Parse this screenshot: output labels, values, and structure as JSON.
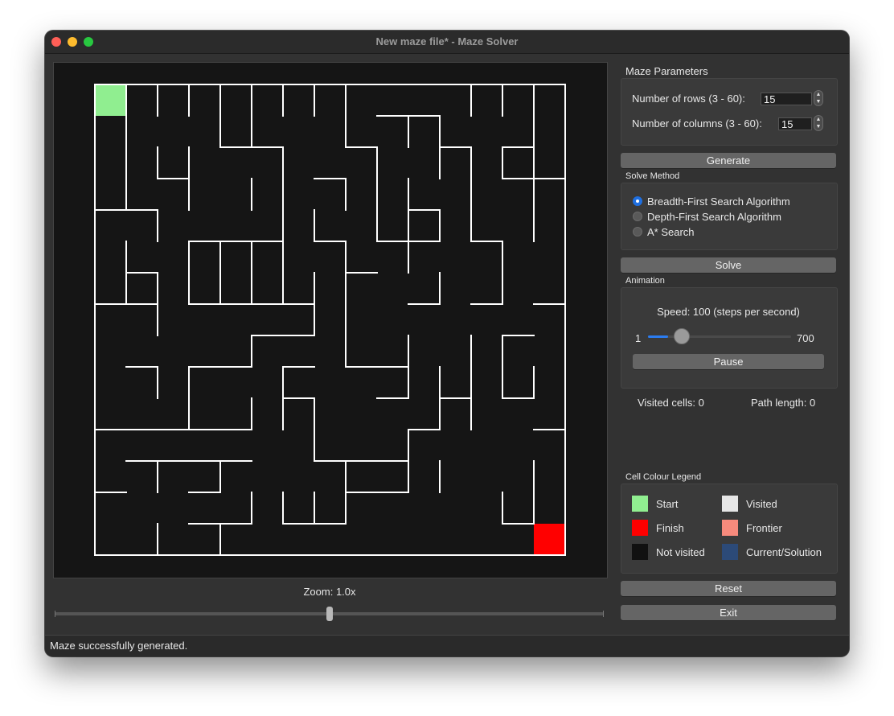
{
  "window": {
    "title": "New maze file* - Maze Solver"
  },
  "maze": {
    "rows": 15,
    "columns": 15,
    "start_color": "#90ee90",
    "finish_color": "#ff0000"
  },
  "zoom": {
    "label": "Zoom: 1.0x"
  },
  "parameters": {
    "title": "Maze Parameters",
    "rows_label": "Number of rows (3 - 60):",
    "rows_value": "15",
    "cols_label": "Number of columns (3 - 60):",
    "cols_value": "15"
  },
  "buttons": {
    "generate": "Generate",
    "solve": "Solve",
    "pause": "Pause",
    "reset": "Reset",
    "exit": "Exit"
  },
  "solve_method": {
    "title": "Solve Method",
    "options": [
      {
        "label": "Breadth-First Search Algorithm",
        "selected": true
      },
      {
        "label": "Depth-First Search Algorithm",
        "selected": false
      },
      {
        "label": "A* Search",
        "selected": false
      }
    ]
  },
  "animation": {
    "title": "Animation",
    "speed_label": "Speed: 100 (steps per second)",
    "min": "1",
    "max": "700",
    "speed": 100
  },
  "stats": {
    "visited": "Visited cells: 0",
    "path_length": "Path length: 0"
  },
  "legend": {
    "title": "Cell Colour Legend",
    "items": [
      {
        "label": "Start",
        "color": "#90ee90"
      },
      {
        "label": "Visited",
        "color": "#e6e6e6"
      },
      {
        "label": "Finish",
        "color": "#ff0000"
      },
      {
        "label": "Frontier",
        "color": "#f78a7c"
      },
      {
        "label": "Not visited",
        "color": "#111111"
      },
      {
        "label": "Current/Solution",
        "color": "#2c4a78"
      }
    ]
  },
  "status": {
    "message": "Maze successfully generated."
  }
}
